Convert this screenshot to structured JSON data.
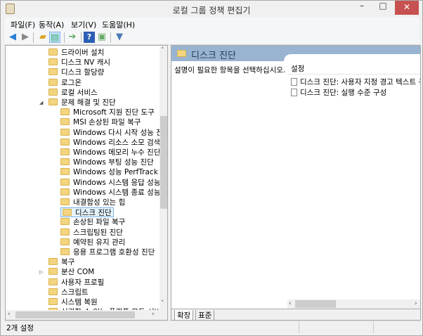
{
  "window": {
    "title": "로컬 그룹 정책 편집기",
    "minimize": "–",
    "maximize": "□",
    "close": "✕"
  },
  "menu": [
    "파일(F)",
    "동작(A)",
    "보기(V)",
    "도움말(H)"
  ],
  "toolbar": [
    "back-icon",
    "forward-icon",
    "up-folder-icon",
    "show-hide-tree-icon",
    "export-list-icon",
    "help-icon",
    "show-action-pane-icon",
    "filter-icon"
  ],
  "tree": [
    {
      "label": "드라이버 설치",
      "level": 1
    },
    {
      "label": "디스크 NV 캐시",
      "level": 1
    },
    {
      "label": "디스크 할당량",
      "level": 1
    },
    {
      "label": "로그온",
      "level": 1
    },
    {
      "label": "로컬 서비스",
      "level": 1
    },
    {
      "label": "문제 해결 및 진단",
      "level": 1,
      "expanded": true
    },
    {
      "label": "Microsoft 지원 진단 도구",
      "level": 2
    },
    {
      "label": "MSI 손상된 파일 복구",
      "level": 2
    },
    {
      "label": "Windows 다시 시작 성능 진단",
      "level": 2
    },
    {
      "label": "Windows 리소스 소모 검색 및",
      "level": 2
    },
    {
      "label": "Windows 메모리 누수 진단",
      "level": 2
    },
    {
      "label": "Windows 부팅 성능 진단",
      "level": 2
    },
    {
      "label": "Windows 성능 PerfTrack",
      "level": 2
    },
    {
      "label": "Windows 시스템 응답 성능 진",
      "level": 2
    },
    {
      "label": "Windows 시스템 종료 성능 진",
      "level": 2
    },
    {
      "label": "내결함성 있는 힙",
      "level": 2
    },
    {
      "label": "디스크 진단",
      "level": 2,
      "selected": true
    },
    {
      "label": "손상된 파일 복구",
      "level": 2
    },
    {
      "label": "스크립팅된 진단",
      "level": 2
    },
    {
      "label": "예약된 유지 관리",
      "level": 2
    },
    {
      "label": "응용 프로그램 호환성 진단",
      "level": 2
    },
    {
      "label": "복구",
      "level": 1
    },
    {
      "label": "분산 COM",
      "level": 1,
      "collapsed": true
    },
    {
      "label": "사용자 프로필",
      "level": 1
    },
    {
      "label": "스크립트",
      "level": 1
    },
    {
      "label": "시스템 복원",
      "level": 1
    },
    {
      "label": "신뢰할 수 있는 플랫폼 모듈 서비",
      "level": 1
    }
  ],
  "right": {
    "header": "디스크 진단",
    "description": "설명이 필요한 항목을 선택하십시오.",
    "column": "설정",
    "items": [
      "디스크 진단: 사용자 지정 경고 텍스트 구",
      "디스크 진단: 실행 수준 구성"
    ],
    "tabs": [
      "확장",
      "표준"
    ]
  },
  "status": "2개 설정"
}
